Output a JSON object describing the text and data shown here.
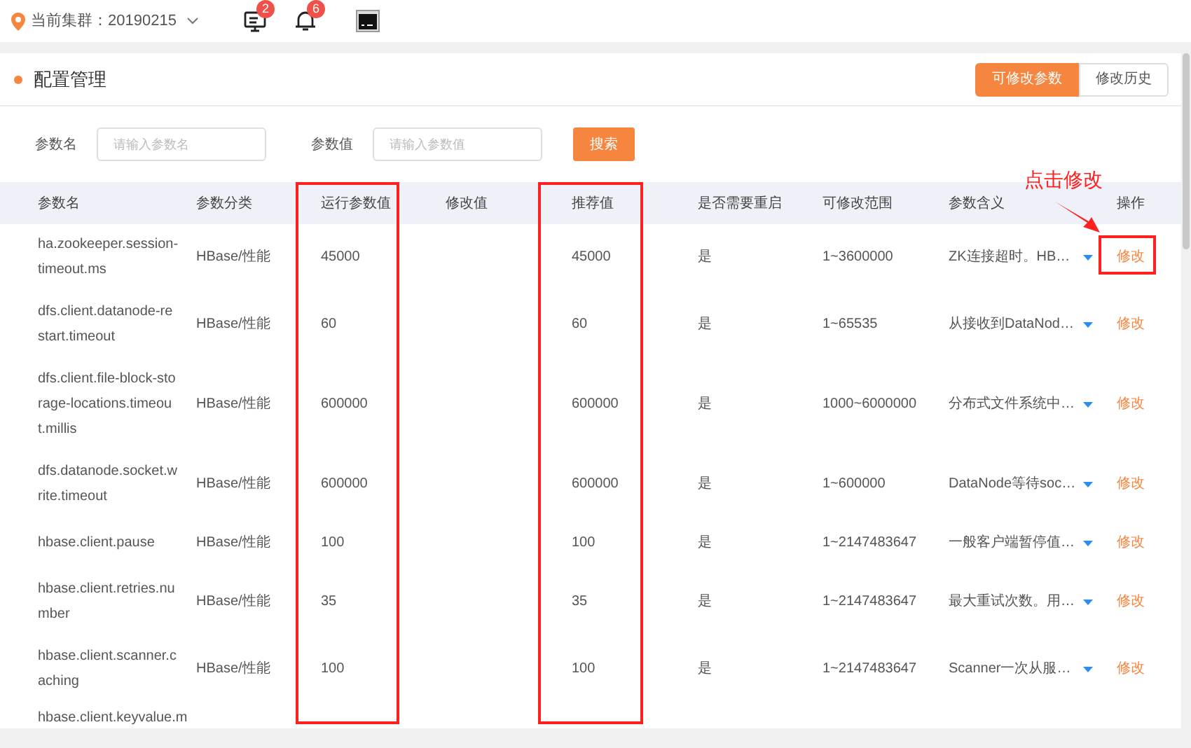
{
  "header": {
    "cluster_label": "当前集群：20190215",
    "notifications": [
      {
        "kind": "monitor",
        "count": "2"
      },
      {
        "kind": "bell",
        "count": "6"
      }
    ]
  },
  "page": {
    "title": "配置管理",
    "tabs": [
      {
        "label": "可修改参数",
        "selected": true
      },
      {
        "label": "修改历史",
        "selected": false
      }
    ]
  },
  "search": {
    "fields": [
      {
        "label": "参数名",
        "placeholder": "请输入参数名"
      },
      {
        "label": "参数值",
        "placeholder": "请输入参数值"
      }
    ],
    "button": "搜索"
  },
  "table": {
    "columns": [
      "参数名",
      "参数分类",
      "运行参数值",
      "修改值",
      "推荐值",
      "是否需要重启",
      "可修改范围",
      "参数含义",
      "操作"
    ],
    "rows": [
      {
        "name": "ha.zookeeper.session-timeout.ms",
        "category": "HBase/性能",
        "running_value": "45000",
        "recommended": "45000",
        "restart": "是",
        "range": "1~3600000",
        "meaning": "ZK连接超时。HB…",
        "action": "修改"
      },
      {
        "name": "dfs.client.datanode-restart.timeout",
        "category": "HBase/性能",
        "running_value": "60",
        "recommended": "60",
        "restart": "是",
        "range": "1~65535",
        "meaning": "从接收到DataNod…",
        "action": "修改"
      },
      {
        "name": "dfs.client.file-block-storage-locations.timeout.millis",
        "category": "HBase/性能",
        "running_value": "600000",
        "recommended": "600000",
        "restart": "是",
        "range": "1000~6000000",
        "meaning": "分布式文件系统中…",
        "action": "修改"
      },
      {
        "name": "dfs.datanode.socket.write.timeout",
        "category": "HBase/性能",
        "running_value": "600000",
        "recommended": "600000",
        "restart": "是",
        "range": "1~600000",
        "meaning": "DataNode等待soc…",
        "action": "修改"
      },
      {
        "name": "hbase.client.pause",
        "category": "HBase/性能",
        "running_value": "100",
        "recommended": "100",
        "restart": "是",
        "range": "1~2147483647",
        "meaning": "一般客户端暂停值…",
        "action": "修改"
      },
      {
        "name": "hbase.client.retries.number",
        "category": "HBase/性能",
        "running_value": "35",
        "recommended": "35",
        "restart": "是",
        "range": "1~2147483647",
        "meaning": "最大重试次数。用…",
        "action": "修改"
      },
      {
        "name": "hbase.client.scanner.caching",
        "category": "HBase/性能",
        "running_value": "100",
        "recommended": "100",
        "restart": "是",
        "range": "1~2147483647",
        "meaning": "Scanner一次从服…",
        "action": "修改"
      },
      {
        "name": "hbase.client.keyvalue.m"
      }
    ]
  },
  "annotation": {
    "text": "点击修改"
  }
}
